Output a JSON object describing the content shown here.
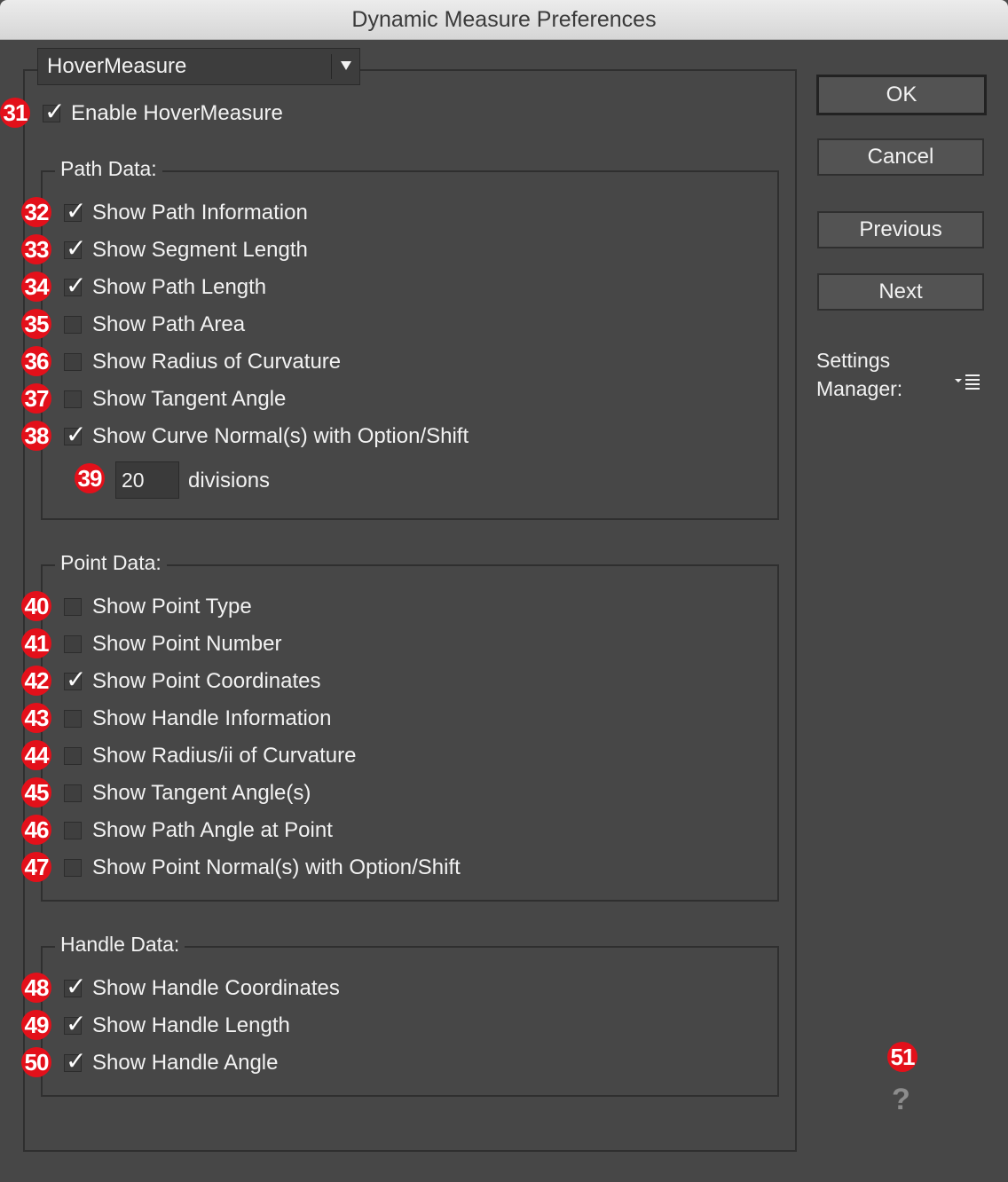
{
  "window": {
    "title": "Dynamic Measure Preferences"
  },
  "panel_select": {
    "value": "HoverMeasure"
  },
  "enable": {
    "badge": "31",
    "label": "Enable HoverMeasure",
    "checked": true
  },
  "path_data": {
    "title": "Path Data:",
    "items": [
      {
        "badge": "32",
        "label": "Show Path Information",
        "checked": true
      },
      {
        "badge": "33",
        "label": "Show Segment Length",
        "checked": true
      },
      {
        "badge": "34",
        "label": "Show Path Length",
        "checked": true
      },
      {
        "badge": "35",
        "label": "Show Path Area",
        "checked": false
      },
      {
        "badge": "36",
        "label": "Show Radius of Curvature",
        "checked": false
      },
      {
        "badge": "37",
        "label": "Show Tangent Angle",
        "checked": false
      },
      {
        "badge": "38",
        "label": "Show Curve Normal(s) with Option/Shift",
        "checked": true
      }
    ],
    "divisions": {
      "badge": "39",
      "value": "20",
      "label": "divisions"
    }
  },
  "point_data": {
    "title": "Point Data:",
    "items": [
      {
        "badge": "40",
        "label": "Show Point Type",
        "checked": false
      },
      {
        "badge": "41",
        "label": "Show Point Number",
        "checked": false
      },
      {
        "badge": "42",
        "label": "Show Point Coordinates",
        "checked": true
      },
      {
        "badge": "43",
        "label": "Show Handle Information",
        "checked": false
      },
      {
        "badge": "44",
        "label": "Show Radius/ii of Curvature",
        "checked": false
      },
      {
        "badge": "45",
        "label": "Show Tangent Angle(s)",
        "checked": false
      },
      {
        "badge": "46",
        "label": "Show Path Angle at Point",
        "checked": false
      },
      {
        "badge": "47",
        "label": "Show Point Normal(s) with Option/Shift",
        "checked": false
      }
    ]
  },
  "handle_data": {
    "title": "Handle Data:",
    "items": [
      {
        "badge": "48",
        "label": "Show Handle Coordinates",
        "checked": true
      },
      {
        "badge": "49",
        "label": "Show Handle Length",
        "checked": true
      },
      {
        "badge": "50",
        "label": "Show Handle Angle",
        "checked": true
      }
    ]
  },
  "buttons": {
    "ok": "OK",
    "cancel": "Cancel",
    "previous": "Previous",
    "next": "Next"
  },
  "settings_manager": {
    "line1": "Settings",
    "line2": "Manager:",
    "icon": "menu-list-icon"
  },
  "help": {
    "badge": "51",
    "icon": "?"
  },
  "colors": {
    "badge": "#e3101a",
    "background": "#474747",
    "title_bar": "#e0e0e0"
  }
}
